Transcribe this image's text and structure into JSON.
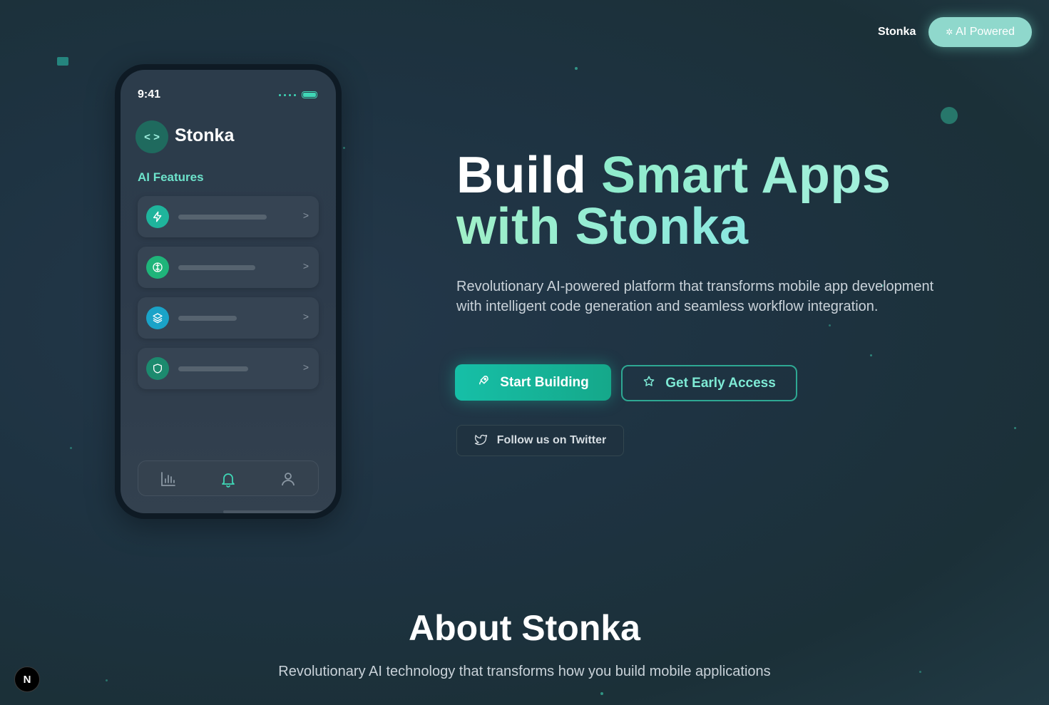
{
  "nav": {
    "brand": "Stonka",
    "badge_label": "AI Powered",
    "badge_icon": "sparkle-icon"
  },
  "phone": {
    "time": "9:41",
    "app_name": "Stonka",
    "features_title": "AI Features",
    "features": [
      {
        "icon": "zap-icon",
        "color": "#1fb49c"
      },
      {
        "icon": "globe-icon",
        "color": "#1fb47a"
      },
      {
        "icon": "layers-icon",
        "color": "#1aa3c8"
      },
      {
        "icon": "shield-icon",
        "color": "#1c8a6e"
      }
    ],
    "chevron": ">",
    "bottom_nav": [
      "chart-icon",
      "bell-icon",
      "user-icon"
    ]
  },
  "hero": {
    "title_word_1": "Build",
    "title_word_2": "Smart Apps",
    "title_line_2": "with Stonka",
    "description": "Revolutionary AI-powered platform that transforms mobile app development with intelligent code generation and seamless workflow integration.",
    "primary_cta": "Start Building",
    "secondary_cta": "Get Early Access",
    "twitter_cta": "Follow us on Twitter"
  },
  "about": {
    "title": "About Stonka",
    "subtitle": "Revolutionary AI technology that transforms how you build mobile applications"
  },
  "framework_badge": "N",
  "colors": {
    "accent": "#3fd6b6",
    "primary_button": "#16bfa7",
    "background": "#1e3342"
  }
}
